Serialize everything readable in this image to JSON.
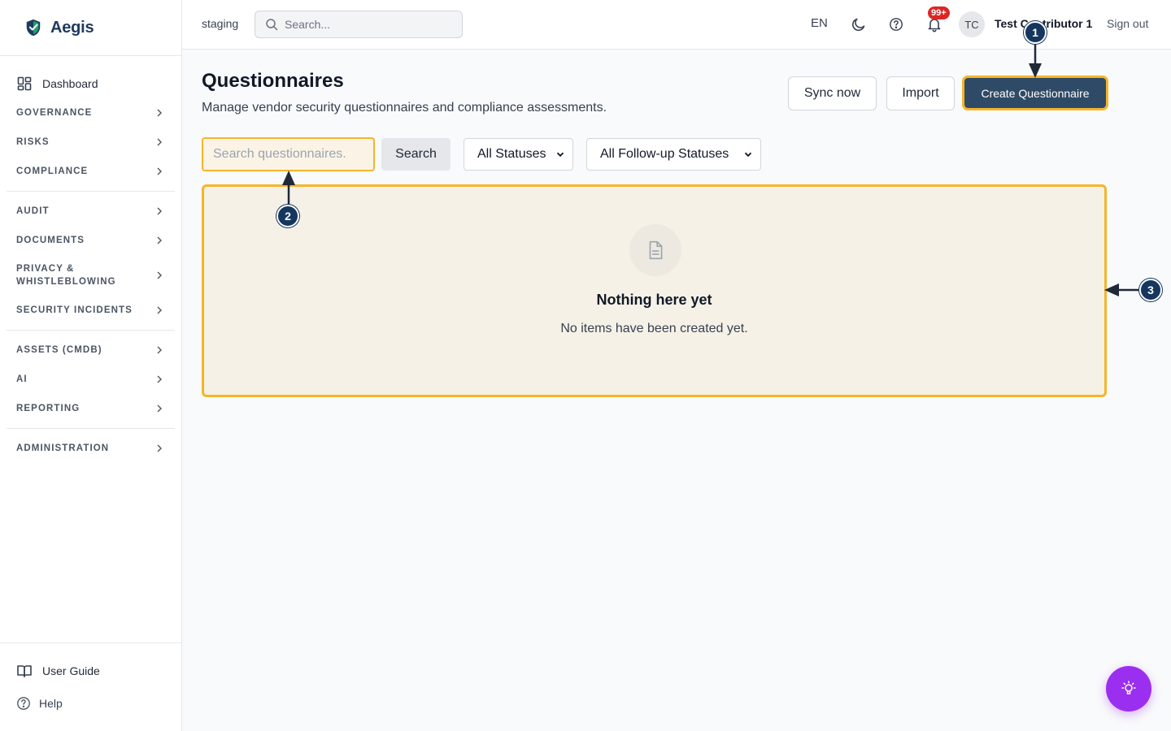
{
  "brand": {
    "name": "Aegis"
  },
  "sidebar": {
    "dashboard": "Dashboard",
    "groups": [
      {
        "label": "GOVERNANCE"
      },
      {
        "label": "RISKS"
      },
      {
        "label": "COMPLIANCE"
      },
      {
        "label": "AUDIT"
      },
      {
        "label": "DOCUMENTS"
      },
      {
        "label_line1": "PRIVACY &",
        "label_line2": "WHISTLEBLOWING"
      },
      {
        "label": "SECURITY INCIDENTS"
      },
      {
        "label": "ASSETS (CMDB)"
      },
      {
        "label": "AI"
      },
      {
        "label": "REPORTING"
      },
      {
        "label": "ADMINISTRATION"
      }
    ],
    "bottom": {
      "user_guide": "User Guide",
      "help": "Help"
    }
  },
  "topbar": {
    "environment": "staging",
    "search_placeholder": "Search...",
    "language": "EN",
    "notifications_badge": "99+",
    "avatar_initials": "TC",
    "user_name": "Test Contributor 1",
    "sign_out": "Sign out"
  },
  "page": {
    "title": "Questionnaires",
    "subtitle": "Manage vendor security questionnaires and compliance assessments.",
    "actions": {
      "sync": "Sync now",
      "import": "Import",
      "create": "Create Questionnaire"
    },
    "filters": {
      "search_placeholder": "Search questionnaires.",
      "search_button": "Search",
      "status_selected": "All Statuses",
      "followup_selected": "All Follow-up Statuses"
    },
    "empty": {
      "title": "Nothing here yet",
      "text": "No items have been created yet."
    }
  },
  "annotations": [
    "1",
    "2",
    "3"
  ],
  "colors": {
    "highlight": "#f5b52a",
    "primary": "#2f4a66",
    "marker": "#16365e",
    "fab": "#9b2ff0",
    "badge": "#dc2626"
  }
}
